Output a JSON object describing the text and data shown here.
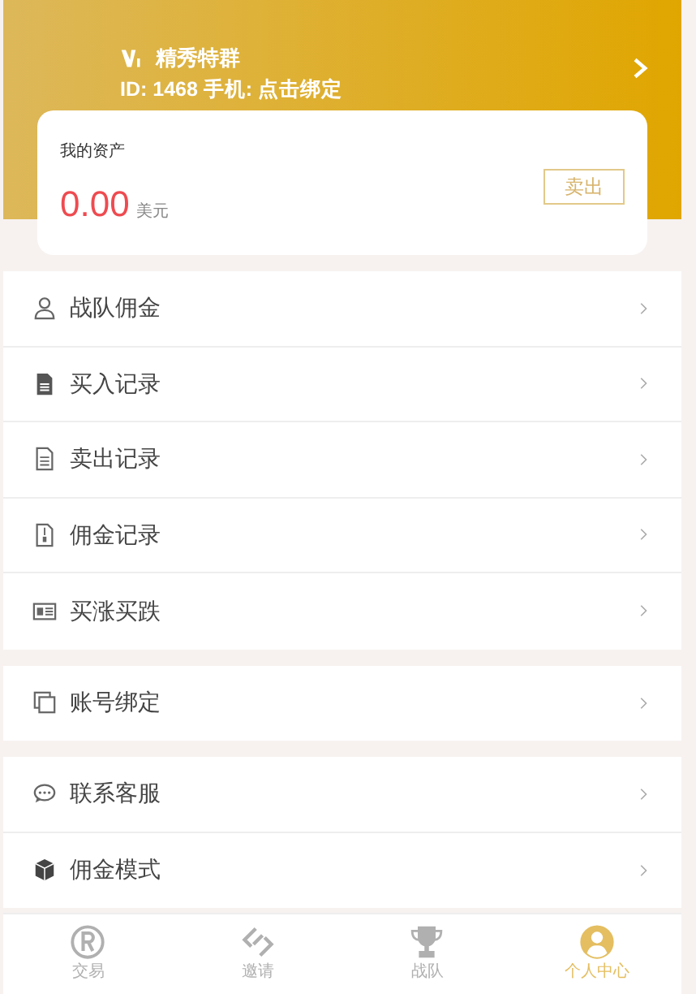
{
  "profile": {
    "name": "精秀特群",
    "info": "ID: 1468 手机: 点击绑定"
  },
  "assets": {
    "title": "我的资产",
    "amount": "0.00",
    "unit": "美元",
    "button": "卖出"
  },
  "menu_groups": [
    {
      "items": [
        {
          "kind": "user",
          "label": "战队佣金"
        },
        {
          "kind": "file-solid",
          "label": "买入记录"
        },
        {
          "kind": "file-lines",
          "label": "卖出记录"
        },
        {
          "kind": "file-zip",
          "label": "佣金记录"
        },
        {
          "kind": "news",
          "label": "买涨买跌"
        }
      ]
    },
    {
      "items": [
        {
          "kind": "copy",
          "label": "账号绑定"
        }
      ]
    },
    {
      "items": [
        {
          "kind": "chat",
          "label": "联系客服"
        },
        {
          "kind": "cube",
          "label": "佣金模式"
        }
      ]
    }
  ],
  "tabs": [
    {
      "kind": "registered",
      "label": "交易",
      "selected": false
    },
    {
      "kind": "link",
      "label": "邀请",
      "selected": false
    },
    {
      "kind": "trophy",
      "label": "战队",
      "selected": false
    },
    {
      "kind": "person",
      "label": "个人中心",
      "selected": true
    }
  ]
}
